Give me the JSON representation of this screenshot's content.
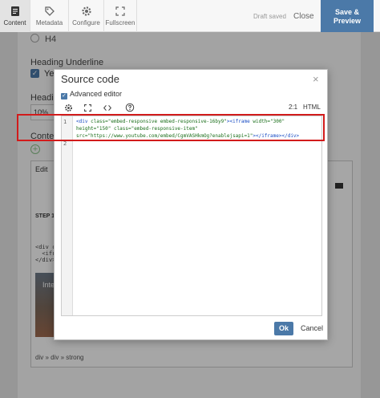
{
  "toolbar": {
    "content": "Content",
    "metadata": "Metadata",
    "configure": "Configure",
    "fullscreen": "Fullscreen",
    "draft_status": "Draft saved",
    "close": "Close",
    "save_preview_line1": "Save &",
    "save_preview_line2": "Preview"
  },
  "background": {
    "h4": "H4",
    "heading_underline": "Heading Underline",
    "yes": "Yes",
    "heading_partial": "Heading",
    "percent_value": "10%",
    "content_label": "Content",
    "edit_menu": "Edit",
    "step_text": "STEP 1.",
    "code_line1": "<div cl",
    "code_line2": "  <ifra",
    "code_line3": "</div>",
    "image_text": "Inte",
    "element_path": "div » div » strong"
  },
  "modal": {
    "title": "Source code",
    "close_glyph": "×",
    "advanced_editor_label": "Advanced editor",
    "cursor_position": "2:1",
    "mode": "HTML",
    "line_numbers": [
      "1",
      "2"
    ],
    "code_part1_open": "<div ",
    "code_part1_attr": "class=\"embed-responsive embed-responsive-16by9\"",
    "code_part2_open": "><iframe ",
    "code_part2_attr": "width=\"300\" height=\"150\" class=\"embed-responsive-item\" src=\"https://www.youtube.com/embed/CgmVASHkmOg?enablejsapi=1\"",
    "code_part3": "></iframe></div>",
    "ok": "Ok",
    "cancel": "Cancel"
  },
  "colors": {
    "accent": "#4b79a8",
    "highlight_border": "#d21b1b"
  }
}
